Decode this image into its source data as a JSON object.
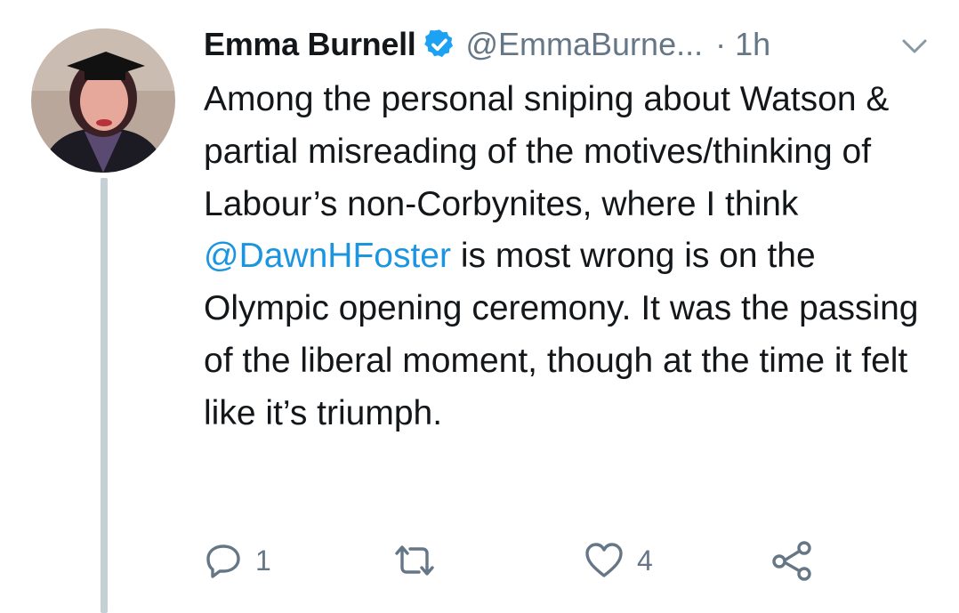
{
  "tweet": {
    "author_name": "Emma Burnell",
    "handle": "@EmmaBurne...",
    "separator": "·",
    "time": "1h",
    "text_before": "Among the personal sniping about Watson & partial misreading of the motives/thinking of Labour’s non-Corbynites, where I think ",
    "mention": "@DawnHFoster",
    "text_after": " is most wrong is on the Olympic opening ceremony. It was the passing of the liberal moment, though at the time it felt like it’s triumph."
  },
  "actions": {
    "reply_count": "1",
    "retweet_count": "",
    "like_count": "4"
  },
  "icons": {
    "verified": "verified-badge-icon",
    "caret": "chevron-down-icon",
    "reply": "reply-icon",
    "retweet": "retweet-icon",
    "like": "heart-icon",
    "share": "share-icon"
  },
  "colors": {
    "text": "#14171a",
    "secondary": "#657786",
    "link": "#1b95e0",
    "verified": "#1da1f2",
    "thread_line": "#c4cfd6"
  }
}
